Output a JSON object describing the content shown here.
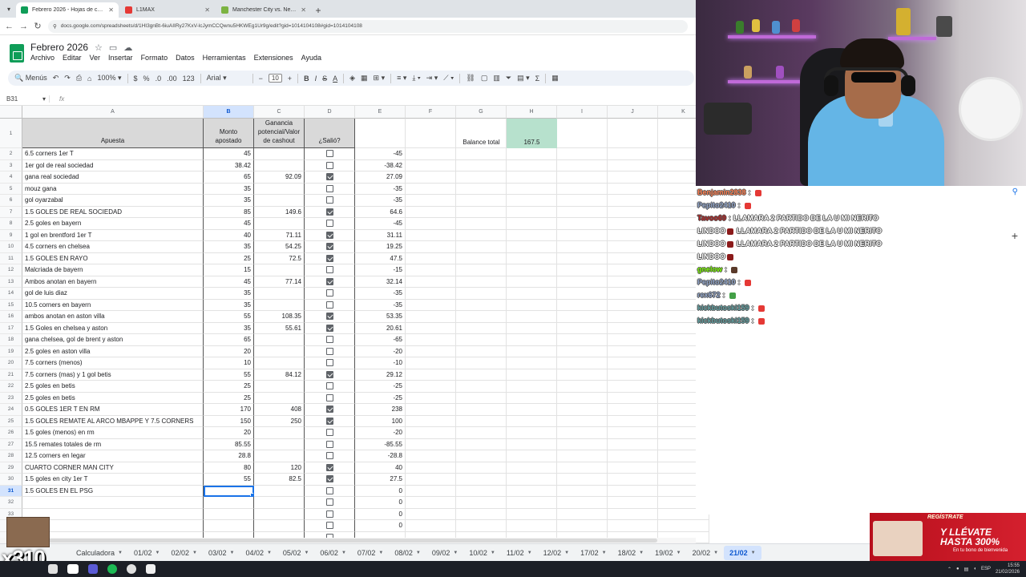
{
  "browser": {
    "tabs": [
      {
        "title": "Febrero 2026 - Hojas de cálculo",
        "color": "#0f9d58",
        "active": true
      },
      {
        "title": "L1MAX",
        "color": "#e53935",
        "active": false
      },
      {
        "title": "Manchester City vs. Newcastle",
        "color": "#7cb342",
        "active": false
      }
    ],
    "url": "docs.google.com/spreadsheets/d/1HI3gnBt-6iuAIIRy27KxV-lcJymCCQwnu5HKWEg1Ur9g/edit?gid=1014104108#gid=1014104108"
  },
  "sheet": {
    "title": "Febrero 2026",
    "menu": [
      "Archivo",
      "Editar",
      "Ver",
      "Insertar",
      "Formato",
      "Datos",
      "Herramientas",
      "Extensiones",
      "Ayuda"
    ],
    "toolbar": {
      "search": "Menús",
      "zoom": "100%",
      "currency": "$",
      "percent": "%",
      "dec_less": ".0",
      "dec_more": ".00",
      "num_format": "123",
      "font": "Arial",
      "font_size": "10"
    },
    "cell_ref": "B31",
    "fx": "fx",
    "columns": [
      "A",
      "B",
      "C",
      "D",
      "E",
      "F",
      "G",
      "H",
      "I",
      "J",
      "K"
    ],
    "headers": {
      "a": "Apuesta",
      "b": "Monto apostado",
      "c": "Ganancia potencial/Valor de cashout",
      "d": "¿Salió?"
    },
    "balance_label": "Balance total",
    "balance_value": "167.5",
    "row_numbers": [
      "1",
      "2",
      "3",
      "4",
      "5",
      "6",
      "7",
      "8",
      "9",
      "10",
      "11",
      "12",
      "13",
      "14",
      "15",
      "16",
      "17",
      "18",
      "19",
      "20",
      "21",
      "22",
      "23",
      "24",
      "25",
      "26",
      "27",
      "28",
      "29",
      "30",
      "31",
      "32",
      "33",
      "34",
      "35"
    ],
    "rows": [
      {
        "a": "6.5 corners 1er T",
        "b": "45",
        "c": "",
        "d": false,
        "e": "-45"
      },
      {
        "a": "1er gol de real sociedad",
        "b": "38.42",
        "c": "",
        "d": false,
        "e": "-38.42"
      },
      {
        "a": "gana real sociedad",
        "b": "65",
        "c": "92.09",
        "d": true,
        "e": "27.09"
      },
      {
        "a": "mouz gana",
        "b": "35",
        "c": "",
        "d": false,
        "e": "-35"
      },
      {
        "a": "gol oyarzabal",
        "b": "35",
        "c": "",
        "d": false,
        "e": "-35"
      },
      {
        "a": "1.5 GOLES DE REAL SOCIEDAD",
        "b": "85",
        "c": "149.6",
        "d": true,
        "e": "64.6"
      },
      {
        "a": "2.5 goles en bayern",
        "b": "45",
        "c": "",
        "d": false,
        "e": "-45"
      },
      {
        "a": "1 gol en brentford 1er T",
        "b": "40",
        "c": "71.11",
        "d": true,
        "e": "31.11"
      },
      {
        "a": "4.5 corners en chelsea",
        "b": "35",
        "c": "54.25",
        "d": true,
        "e": "19.25"
      },
      {
        "a": "1.5 GOLES EN RAYO",
        "b": "25",
        "c": "72.5",
        "d": true,
        "e": "47.5"
      },
      {
        "a": "Malcriada de bayern",
        "b": "15",
        "c": "",
        "d": false,
        "e": "-15"
      },
      {
        "a": "Ambos anotan en bayern",
        "b": "45",
        "c": "77.14",
        "d": true,
        "e": "32.14"
      },
      {
        "a": "gol de luis diaz",
        "b": "35",
        "c": "",
        "d": false,
        "e": "-35"
      },
      {
        "a": "10.5 corners en bayern",
        "b": "35",
        "c": "",
        "d": false,
        "e": "-35"
      },
      {
        "a": "ambos anotan en aston villa",
        "b": "55",
        "c": "108.35",
        "d": true,
        "e": "53.35"
      },
      {
        "a": "1.5 Goles en chelsea y aston",
        "b": "35",
        "c": "55.61",
        "d": true,
        "e": "20.61"
      },
      {
        "a": "gana chelsea, gol de brent y aston",
        "b": "65",
        "c": "",
        "d": false,
        "e": "-65"
      },
      {
        "a": "2.5 goles en aston villa",
        "b": "20",
        "c": "",
        "d": false,
        "e": "-20"
      },
      {
        "a": "7.5 corners (menos)",
        "b": "10",
        "c": "",
        "d": false,
        "e": "-10"
      },
      {
        "a": "7.5 corners (mas) y 1 gol betis",
        "b": "55",
        "c": "84.12",
        "d": true,
        "e": "29.12"
      },
      {
        "a": "2.5 goles en betis",
        "b": "25",
        "c": "",
        "d": false,
        "e": "-25"
      },
      {
        "a": "2.5 goles en betis",
        "b": "25",
        "c": "",
        "d": false,
        "e": "-25"
      },
      {
        "a": "0.5 GOLES 1ER T EN RM",
        "b": "170",
        "c": "408",
        "d": true,
        "e": "238"
      },
      {
        "a": "1.5 GOLES REMATE AL ARCO MBAPPE Y 7.5 CORNERS",
        "b": "150",
        "c": "250",
        "d": true,
        "e": "100"
      },
      {
        "a": "1.5 goles (menos) en rm",
        "b": "20",
        "c": "",
        "d": false,
        "e": "-20"
      },
      {
        "a": "15.5 remates totales de rm",
        "b": "85.55",
        "c": "",
        "d": false,
        "e": "-85.55"
      },
      {
        "a": "12.5 corners en legar",
        "b": "28.8",
        "c": "",
        "d": false,
        "e": "-28.8"
      },
      {
        "a": "CUARTO CORNER MAN CITY",
        "b": "80",
        "c": "120",
        "d": true,
        "e": "40"
      },
      {
        "a": "1.5 goles en city 1er T",
        "b": "55",
        "c": "82.5",
        "d": true,
        "e": "27.5"
      },
      {
        "a": "1.5 GOLES EN EL PSG",
        "b": "",
        "c": "",
        "d": false,
        "e": "0"
      },
      {
        "a": "",
        "b": "",
        "c": "",
        "d": false,
        "e": "0"
      },
      {
        "a": "",
        "b": "",
        "c": "",
        "d": false,
        "e": "0"
      },
      {
        "a": "",
        "b": "",
        "c": "",
        "d": false,
        "e": "0"
      },
      {
        "a": "",
        "b": "",
        "c": "",
        "d": false,
        "e": ""
      }
    ],
    "sheet_tabs": [
      "Calculadora",
      "01/02",
      "02/02",
      "03/02",
      "04/02",
      "05/02",
      "06/02",
      "07/02",
      "08/02",
      "09/02",
      "10/02",
      "11/02",
      "12/02",
      "17/02",
      "18/02",
      "19/02",
      "20/02",
      "21/02"
    ],
    "active_tab": "21/02",
    "balance_color": "#b7e1cd",
    "header_color": "#d9d9d9"
  },
  "chat": [
    {
      "user": "Benjamin2838",
      "msg": "",
      "color": "#ff7f50",
      "emote": "#e53935"
    },
    {
      "user": "Pepito2410",
      "msg": "",
      "color": "#8fa3c8",
      "emote": "#e53935"
    },
    {
      "user": "Tavoo69",
      "msg": "LLAMARA 2 PARTIDO DE LA U MI NERITO",
      "color": "#b22222",
      "emote": ""
    },
    {
      "user": "",
      "msg": "LINDOO",
      "color": "#ffffff",
      "emote": "#8b1a1a",
      "msg2": "LLAMARA 2 PARTIDO DE LA U MI NERITO"
    },
    {
      "user": "",
      "msg": "LINDOO",
      "color": "#ffffff",
      "emote": "#8b1a1a",
      "msg2": "LLAMARA 2 PARTIDO DE LA U MI NERITO"
    },
    {
      "user": "",
      "msg": "LINDOO",
      "color": "#ffffff",
      "emote": "#8b1a1a",
      "msg2": ""
    },
    {
      "user": "gnelow",
      "msg": "",
      "color": "#7cfc00",
      "emote": "#5a3a2a"
    },
    {
      "user": "Pepito2410",
      "msg": "",
      "color": "#8fa3c8",
      "emote": "#e53935"
    },
    {
      "user": "rex672",
      "msg": "",
      "color": "#8fa3c8",
      "emote": "#43a047"
    },
    {
      "user": "kickbutoski159",
      "msg": "",
      "color": "#5f9ea0",
      "emote": "#e53935"
    },
    {
      "user": "kickbutoski159",
      "msg": "",
      "color": "#5f9ea0",
      "emote": "#e53935"
    }
  ],
  "overlay": {
    "banner_top": "REGÍSTRATE",
    "banner_main": "Y LLÉVATE HASTA 300%",
    "banner_sub": "En tu bono de bienvenida",
    "multiplier": "x310"
  },
  "taskbar": {
    "time": "15:55",
    "date": "21/02/2026",
    "lang": "ESP"
  }
}
